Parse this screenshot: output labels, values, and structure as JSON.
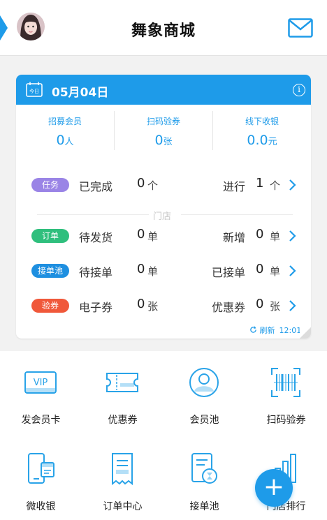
{
  "header": {
    "title": "舞象商城",
    "avatar_icon": "avatar-photo",
    "mail_icon": "mail-icon"
  },
  "card": {
    "date": "05月04日",
    "calendar_label": "今日",
    "stats": [
      {
        "label": "招募会员",
        "value": "0",
        "unit": "人"
      },
      {
        "label": "扫码验券",
        "value": "0",
        "unit": "张"
      },
      {
        "label": "线下收银",
        "value": "0.0",
        "unit": "元"
      }
    ],
    "task_row": {
      "badge": "任务",
      "badge_color": "#9a84e6",
      "label1": "已完成",
      "num1": "0",
      "unit1": "个",
      "label2": "进行",
      "num2": "1",
      "unit2": "个"
    },
    "section_label": "门店",
    "rows": [
      {
        "badge": "订单",
        "badge_color": "#2fbf7d",
        "label1": "待发货",
        "num1": "0",
        "unit1": "单",
        "label2": "新增",
        "num2": "0",
        "unit2": "单"
      },
      {
        "badge": "接单池",
        "badge_color": "#1e8fe0",
        "label1": "待接单",
        "num1": "0",
        "unit1": "单",
        "label2": "已接单",
        "num2": "0",
        "unit2": "单"
      },
      {
        "badge": "验券",
        "badge_color": "#f0583a",
        "label1": "电子券",
        "num1": "0",
        "unit1": "张",
        "label2": "优惠券",
        "num2": "0",
        "unit2": "张"
      }
    ],
    "refresh_label": "刷新",
    "refresh_time": "12:01"
  },
  "grid": [
    {
      "label": "发会员卡",
      "icon": "vip-card-icon"
    },
    {
      "label": "优惠券",
      "icon": "coupon-icon"
    },
    {
      "label": "会员池",
      "icon": "member-icon"
    },
    {
      "label": "扫码验券",
      "icon": "barcode-scan-icon"
    },
    {
      "label": "微收银",
      "icon": "mobile-cashier-icon"
    },
    {
      "label": "订单中心",
      "icon": "receipt-icon"
    },
    {
      "label": "接单池",
      "icon": "order-pool-icon"
    },
    {
      "label": "门店排行",
      "icon": "ranking-icon"
    }
  ],
  "colors": {
    "accent": "#1e9be9"
  }
}
